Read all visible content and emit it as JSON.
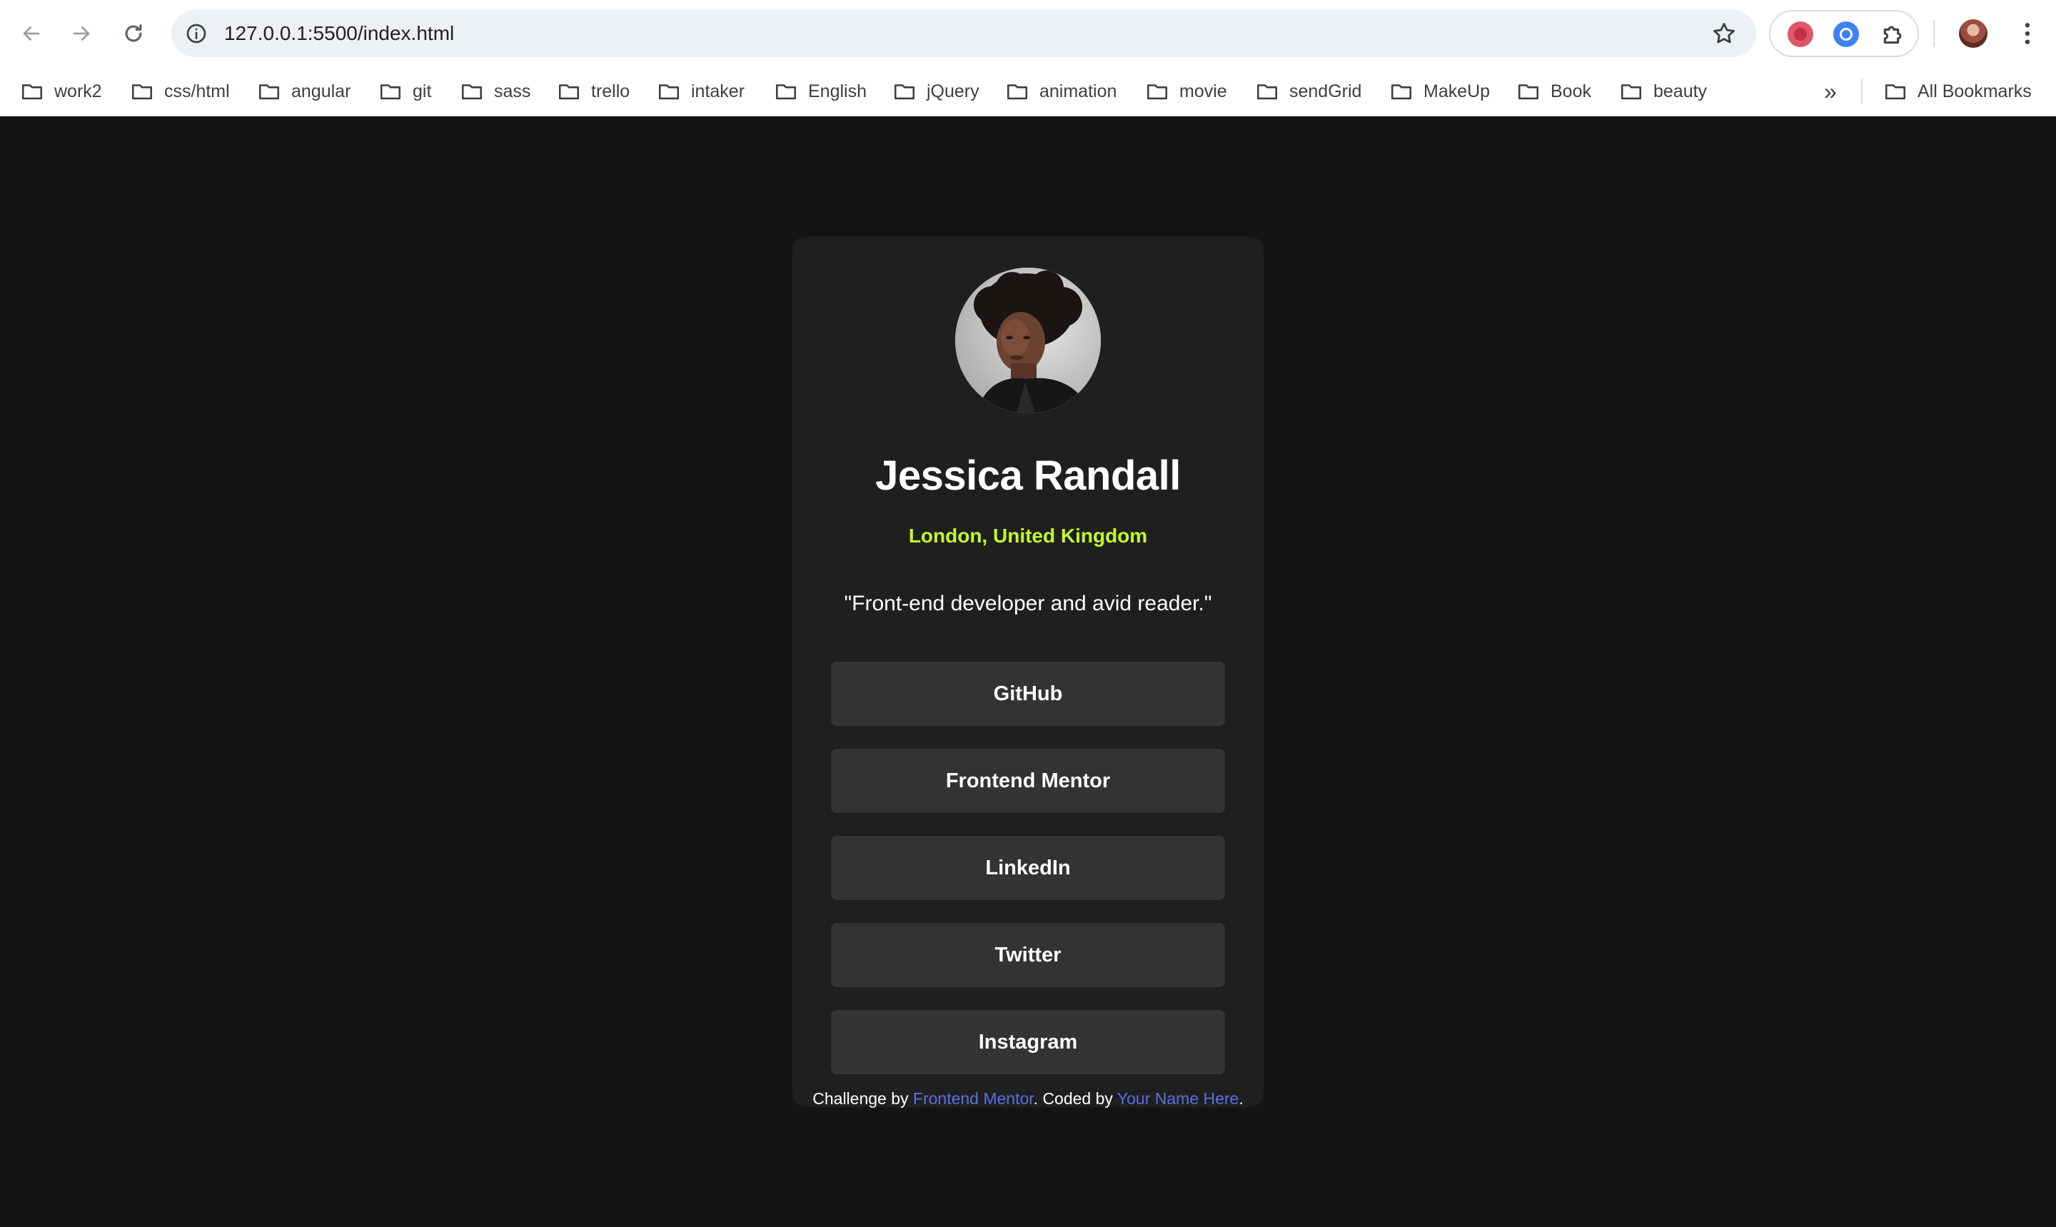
{
  "browser": {
    "url": "127.0.0.1:5500/index.html",
    "bookmarks": [
      {
        "label": "work2"
      },
      {
        "label": "css/html"
      },
      {
        "label": "angular"
      },
      {
        "label": "git"
      },
      {
        "label": "sass"
      },
      {
        "label": "trello"
      },
      {
        "label": "intaker"
      },
      {
        "label": "English"
      },
      {
        "label": "jQuery"
      },
      {
        "label": "animation"
      },
      {
        "label": "movie"
      },
      {
        "label": "sendGrid"
      },
      {
        "label": "MakeUp"
      },
      {
        "label": "Book"
      },
      {
        "label": "beauty"
      }
    ],
    "more_bookmarks_glyph": "»",
    "all_bookmarks_label": "All Bookmarks"
  },
  "profile": {
    "name": "Jessica Randall",
    "location": "London, United Kingdom",
    "bio": "\"Front-end developer and avid reader.\"",
    "links": [
      {
        "label": "GitHub"
      },
      {
        "label": "Frontend Mentor"
      },
      {
        "label": "LinkedIn"
      },
      {
        "label": "Twitter"
      },
      {
        "label": "Instagram"
      }
    ]
  },
  "attribution": {
    "prefix": "Challenge by ",
    "link1": "Frontend Mentor",
    "middle": ". Coded by ",
    "link2": "Your Name Here",
    "suffix": "."
  },
  "colors": {
    "page_bg": "#141414",
    "card_bg": "#1f1f1f",
    "button_bg": "#333333",
    "accent_green": "#c5f82a",
    "link_blue": "#5b6ee1"
  }
}
